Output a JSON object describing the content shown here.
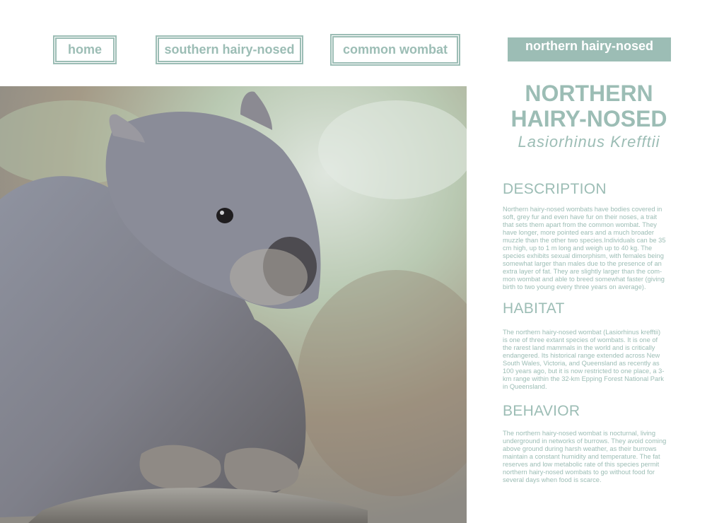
{
  "nav": {
    "home": "home",
    "southern": "southern hairy-nosed",
    "common": "common wombat",
    "northern": "northern hairy-nosed"
  },
  "colors": {
    "accent": "#9cbdb5",
    "background": "#ffffff"
  },
  "hero": {
    "title_line1": "NORTHERN",
    "title_line2": "HAIRY-NOSED",
    "latin": "Lasiorhinus Krefftii"
  },
  "sections": [
    {
      "heading": "DESCRIPTION",
      "text": "Northern hairy-nosed wombats have bodies covered in soft, grey fur and even have fur on their noses, a trait that sets them apart from the common wombat. They have longer, more pointed ears and a much broader muzzle than the other two species.Individuals can be 35 cm high, up to 1 m long and weigh up to 40 kg. The species exhibits sexual dimorphism, with females being somewhat larger than males due to the presence of an extra layer of fat. They are slightly larger than the com-mon wombat and able to breed somewhat faster (giving birth to two young every three years on average)."
    },
    {
      "heading": "HABITAT",
      "text": "The northern hairy-nosed wombat (Lasiorhinus krefftii) is one of three extant species of wombats. It is one of the rarest land mammals in the world and is critically endangered. Its historical range extended across New South Wales, Victoria, and Queensland as recently as 100 years ago, but it is now restricted to one place, a 3-km range within the 32-km Epping Forest National Park in Queensland."
    },
    {
      "heading": "BEHAVIOR",
      "text": "The northern hairy-nosed wombat is nocturnal, living underground in networks of burrows. They avoid coming above ground during harsh weather, as their burrows maintain a constant humidity and temperature. The fat reserves and low metabolic rate of this species permit northern hairy-nosed wombats to go without food for several days when food is scarce."
    }
  ]
}
